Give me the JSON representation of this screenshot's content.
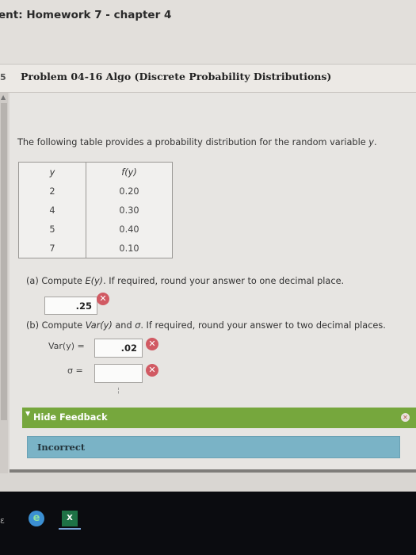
{
  "header": {
    "assignment_title": "ent: Homework 7 - chapter 4"
  },
  "problem": {
    "index_marker": "5",
    "title": "Problem 04-16 Algo (Discrete Probability Distributions)",
    "intro": {
      "before": "The following table provides a probability distribution for the random variable ",
      "var": "y",
      "after": "."
    }
  },
  "table": {
    "headers": [
      "y",
      "f(y)"
    ],
    "rows": [
      [
        "2",
        "0.20"
      ],
      [
        "4",
        "0.30"
      ],
      [
        "5",
        "0.40"
      ],
      [
        "7",
        "0.10"
      ]
    ]
  },
  "part_a": {
    "label": "(a) Compute ",
    "expr": "E(y)",
    "after": ". If required, round your answer to one decimal place.",
    "answer": ".25"
  },
  "part_b": {
    "label": "(b) Compute ",
    "expr1": "Var(y)",
    "mid": " and ",
    "expr2": "σ",
    "after": ". If required, round your answer to two decimal places.",
    "var_label": "Var(y) =",
    "var_answer": ".02",
    "sigma_label": "σ =",
    "sigma_answer": ""
  },
  "feedback": {
    "toggle_label": "Hide Feedback",
    "result": "Incorrect"
  },
  "icons": {
    "incorrect": "x-circle-icon",
    "collapse": "triangle-down-icon"
  },
  "colors": {
    "incorrect_red": "#d15a63",
    "feedback_green": "#76a73d",
    "incorrect_blue": "#7ab3c6"
  },
  "taskbar": {
    "excel_glyph": "X"
  }
}
